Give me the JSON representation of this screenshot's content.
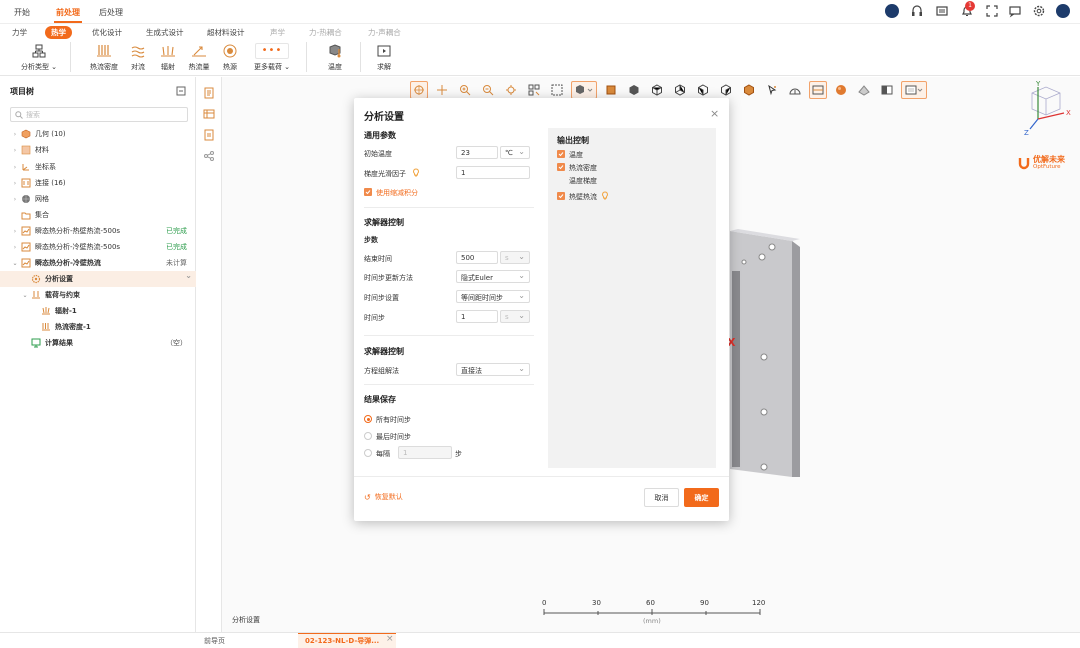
{
  "menu_tabs": [
    "开始",
    "前处理",
    "后处理"
  ],
  "sub_tabs": [
    "力学",
    "热学",
    "优化设计",
    "生成式设计",
    "超材料设计",
    "声学",
    "力-热耦合",
    "力-声耦合"
  ],
  "ribbon": {
    "analysis_type": "分析类型",
    "heat_flux_density": "热流密度",
    "convection": "对流",
    "radiation": "辐射",
    "heat_flow": "热流量",
    "heat_source": "热源",
    "more_loads": "更多载荷",
    "temperature": "温度",
    "solve": "求解"
  },
  "notifications": {
    "count": "1"
  },
  "brand": {
    "name": "优解未来",
    "sub": "OptFuture",
    "accent": "#f26a1b"
  },
  "tree": {
    "title": "项目树",
    "search_placeholder": "搜索",
    "items": [
      {
        "label": "几何 (10)",
        "icon": "cube-icon",
        "status": ""
      },
      {
        "label": "材料",
        "icon": "material-icon",
        "status": ""
      },
      {
        "label": "坐标系",
        "icon": "axes-icon",
        "status": ""
      },
      {
        "label": "连接 (16)",
        "icon": "connection-icon",
        "status": ""
      },
      {
        "label": "网格",
        "icon": "mesh-icon",
        "status": ""
      },
      {
        "label": "集合",
        "icon": "folder-icon",
        "status": ""
      },
      {
        "label": "瞬态热分析-热壁热流-500s",
        "icon": "analysis-icon",
        "status": "已完成"
      },
      {
        "label": "瞬态热分析-冷壁热流-500s",
        "icon": "analysis-icon",
        "status": "已完成"
      },
      {
        "label": "瞬态热分析-冷壁热流",
        "icon": "analysis-icon",
        "status": "未计算"
      },
      {
        "label": "分析设置",
        "icon": "gear-icon",
        "status": ""
      },
      {
        "label": "载荷与约束",
        "icon": "load-icon",
        "status": ""
      },
      {
        "label": "辐射-1",
        "icon": "radiation-icon",
        "status": ""
      },
      {
        "label": "热流密度-1",
        "icon": "heat-flux-icon",
        "status": ""
      },
      {
        "label": "计算结果",
        "icon": "result-icon",
        "status": "（空）"
      }
    ]
  },
  "dialog": {
    "title": "分析设置",
    "general": {
      "heading": "通用参数",
      "init_temp_label": "初始温度",
      "init_temp_value": "23",
      "init_temp_unit": "℃",
      "gradient_label": "梯度光滑因子",
      "gradient_value": "1",
      "reduced_integration": "使用缩减积分"
    },
    "solver": {
      "heading": "求解器控制",
      "step_heading": "步数",
      "end_time_label": "结束时间",
      "end_time_value": "500",
      "end_time_unit": "s",
      "method_label": "时间步更新方法",
      "method_value": "隐式Euler",
      "step_setting_label": "时间步设置",
      "step_setting_value": "等间距时间步",
      "time_step_label": "时间步",
      "time_step_value": "1",
      "time_step_unit": "s"
    },
    "solver2": {
      "heading": "求解器控制",
      "eq_label": "方程组解法",
      "eq_value": "直接法"
    },
    "save": {
      "heading": "结果保存",
      "all": "所有时间步",
      "last": "最后时间步",
      "every": "每隔",
      "every_value": "1",
      "every_unit": "步"
    },
    "output": {
      "heading": "输出控制",
      "temperature": "温度",
      "heat_flux_density": "热流密度",
      "temp_gradient": "温度梯度",
      "wall_heat_flux": "热壁热流"
    },
    "reset": "恢复默认",
    "cancel": "取消",
    "ok": "确定"
  },
  "scale": {
    "ticks": [
      "0",
      "30",
      "60",
      "90",
      "120"
    ],
    "unit": "(mm)"
  },
  "status_label": "分析设置",
  "bottom_tabs": [
    "前导页",
    "02-123-NL-D-导弹..."
  ]
}
